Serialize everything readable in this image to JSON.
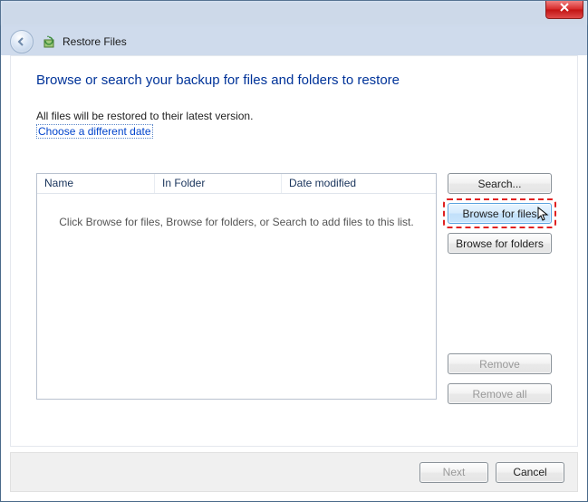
{
  "window": {
    "title": "Restore Files"
  },
  "page": {
    "heading": "Browse or search your backup for files and folders to restore",
    "subtext": "All files will be restored to their latest version.",
    "link": "Choose a different date"
  },
  "list": {
    "columns": {
      "name": "Name",
      "folder": "In Folder",
      "date": "Date modified"
    },
    "empty": "Click Browse for files, Browse for folders, or Search to add files to this list."
  },
  "buttons": {
    "search": "Search...",
    "browse_files": "Browse for files",
    "browse_folders": "Browse for folders",
    "remove": "Remove",
    "remove_all": "Remove all",
    "next": "Next",
    "cancel": "Cancel"
  }
}
